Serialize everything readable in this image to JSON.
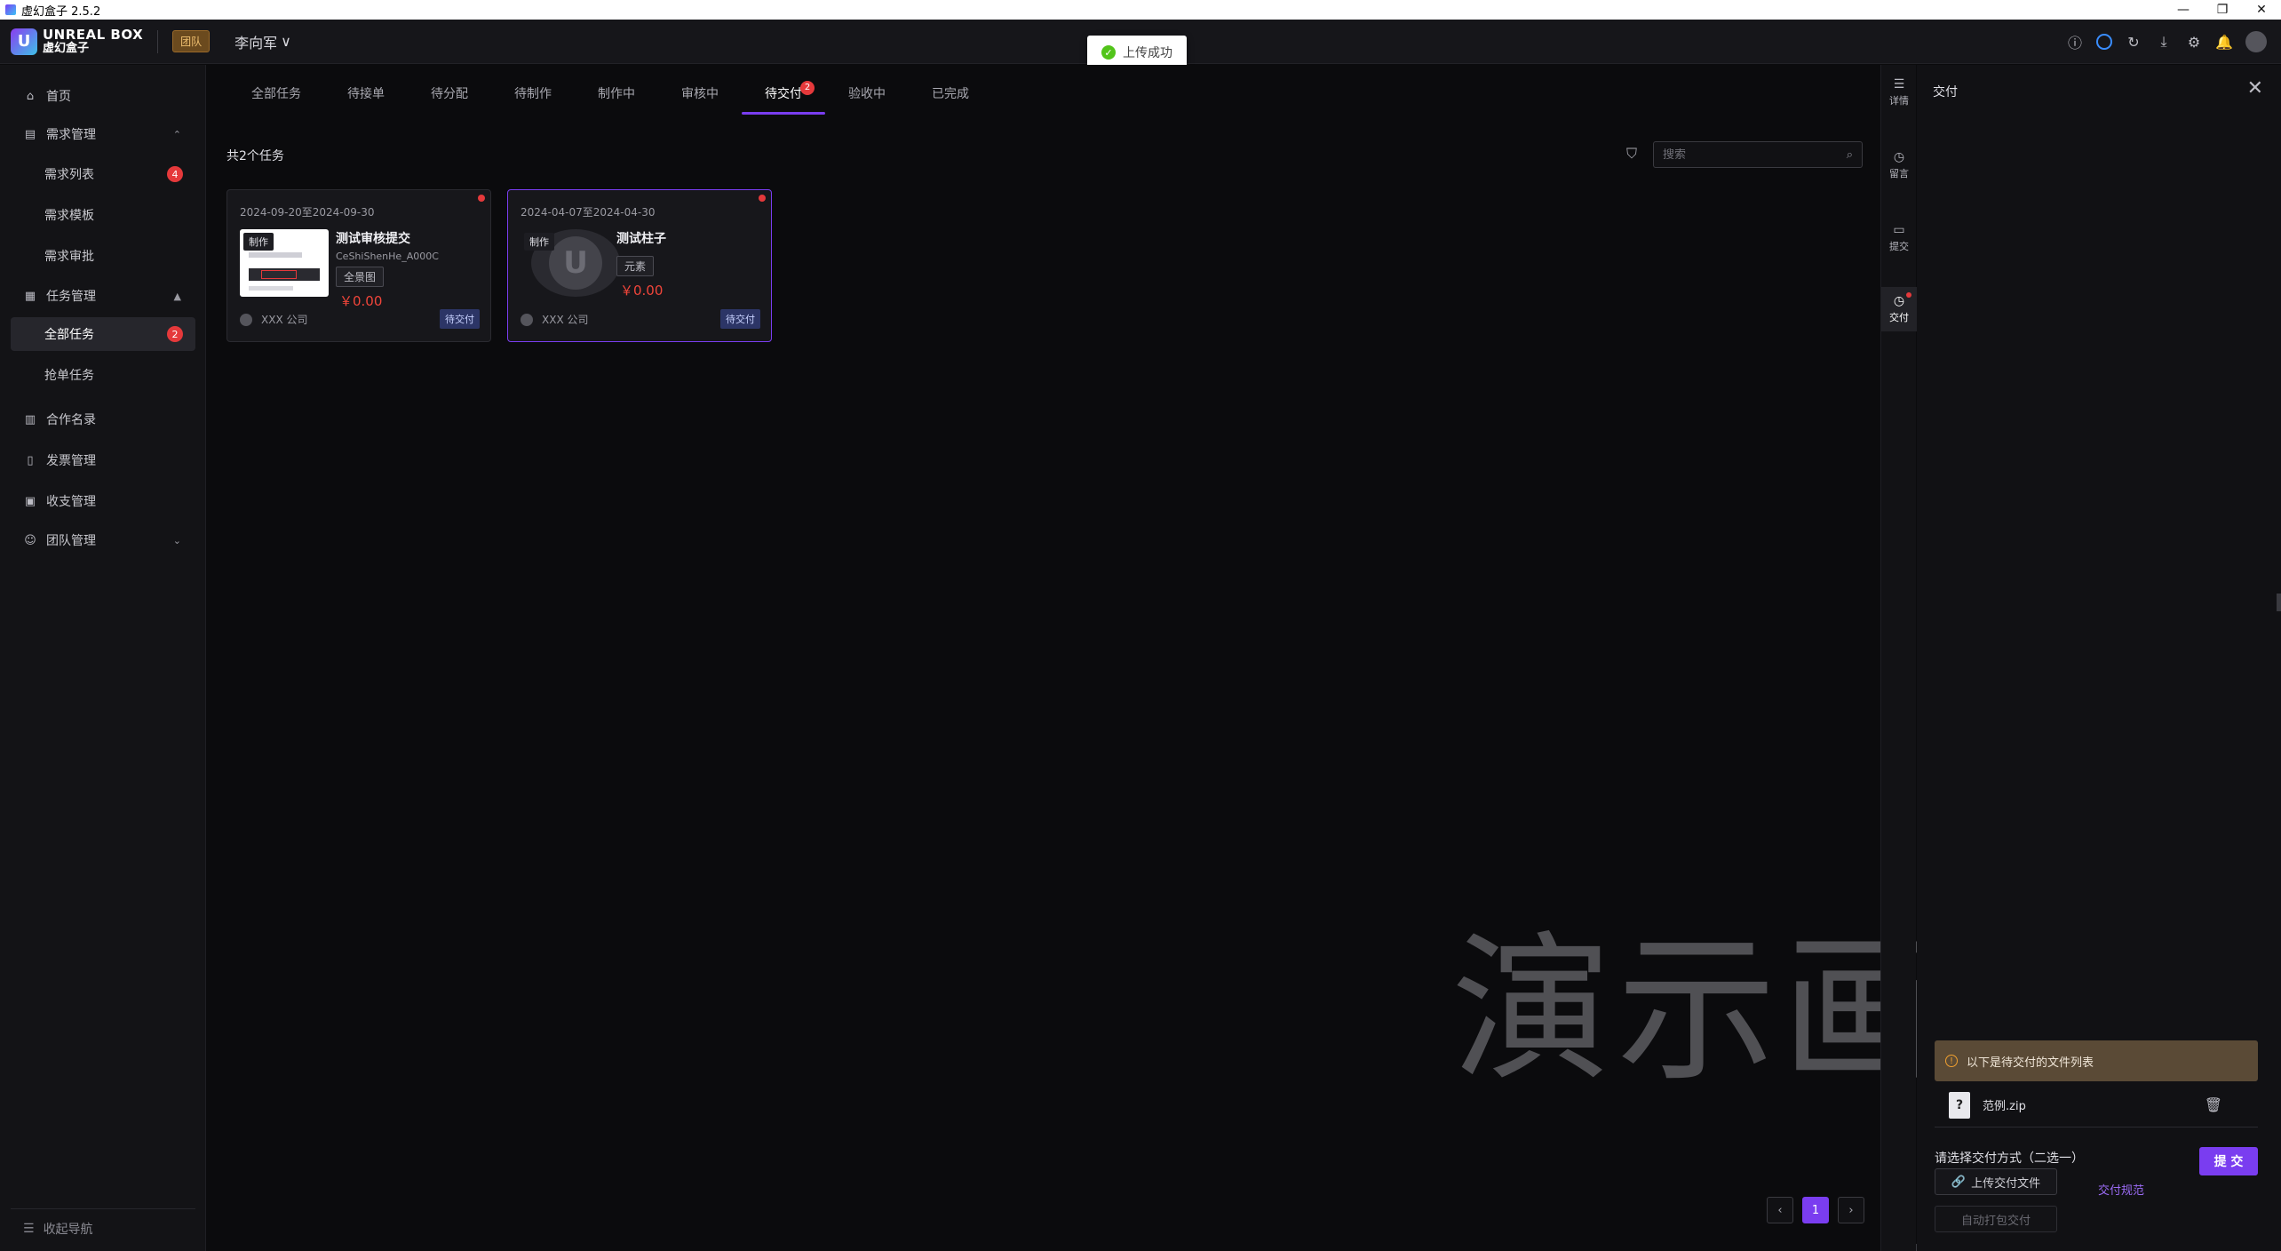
{
  "window": {
    "title": "虚幻盒子 2.5.2",
    "controls": [
      "—",
      "❐",
      "✕"
    ]
  },
  "header": {
    "logo_en": "UNREAL BOX",
    "logo_cn": "虚幻盒子",
    "team_badge": "团队",
    "user": "李向军",
    "icons": [
      "help-icon",
      "status-ring-icon",
      "refresh-icon",
      "download-icon",
      "settings-icon",
      "bell-icon",
      "avatar"
    ]
  },
  "toast": {
    "message": "上传成功"
  },
  "sidebar": {
    "home": "首页",
    "demand_mgmt": "需求管理",
    "demand_list": "需求列表",
    "demand_list_badge": "4",
    "demand_template": "需求模板",
    "demand_approval": "需求审批",
    "task_mgmt": "任务管理",
    "all_tasks": "全部任务",
    "all_tasks_badge": "2",
    "grab_tasks": "抢单任务",
    "partners": "合作名录",
    "invoice": "发票管理",
    "finance": "收支管理",
    "team": "团队管理",
    "collapse": "收起导航"
  },
  "tabs": [
    {
      "label": "全部任务"
    },
    {
      "label": "待接单"
    },
    {
      "label": "待分配"
    },
    {
      "label": "待制作"
    },
    {
      "label": "制作中"
    },
    {
      "label": "审核中"
    },
    {
      "label": "待交付",
      "badge": "2"
    },
    {
      "label": "验收中"
    },
    {
      "label": "已完成"
    }
  ],
  "list": {
    "count_text": "共2个任务",
    "search_placeholder": "搜索"
  },
  "cards": [
    {
      "date": "2024-09-20至2024-09-30",
      "category": "制作",
      "name": "测试审核提交",
      "code": "CeShiShenHe_A000C",
      "tag": "全景图",
      "price": "￥0.00",
      "company": "XXX 公司",
      "status": "待交付"
    },
    {
      "date": "2024-04-07至2024-04-30",
      "category": "制作",
      "name": "测试柱子",
      "tag": "元素",
      "price": "￥0.00",
      "company": "XXX 公司",
      "status": "待交付"
    }
  ],
  "pager": {
    "prev": "‹",
    "current": "1",
    "next": "›"
  },
  "watermark": "演示画面",
  "rail": [
    {
      "label": "详情",
      "icon": "list-icon"
    },
    {
      "label": "留言",
      "icon": "clock-icon"
    },
    {
      "label": "提交",
      "icon": "folder-icon"
    },
    {
      "label": "交付",
      "icon": "clock-icon"
    }
  ],
  "panel": {
    "title": "交付",
    "pending_notice": "以下是待交付的文件列表",
    "file_name": "范例.zip",
    "deliver_method": "请选择交付方式（二选一）",
    "submit": "提 交",
    "upload": "上传交付文件",
    "spec": "交付规范",
    "auto_pack": "自动打包交付"
  }
}
